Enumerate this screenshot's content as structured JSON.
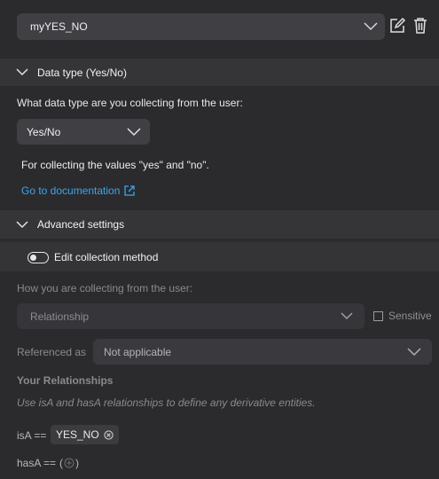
{
  "top": {
    "field_name": "myYES_NO"
  },
  "data_type_section": {
    "title": "Data type (Yes/No)",
    "question": "What data type are you collecting from the user:",
    "selected_type": "Yes/No",
    "description": "For collecting the values \"yes\" and \"no\".",
    "doc_link": "Go to documentation"
  },
  "advanced_section": {
    "title": "Advanced settings",
    "toggle_label": "Edit collection method",
    "toggle_on": false,
    "collecting_label": "How you are collecting from the user:",
    "collecting_value": "Relationship",
    "sensitive_label": "Sensitive",
    "sensitive_checked": false,
    "referenced_label": "Referenced as",
    "referenced_value": "Not applicable",
    "relationships_title": "Your Relationships",
    "relationships_hint": "Use isA and hasA relationships to define any derivative entities.",
    "isa_label": "isA ==",
    "isa_chip": "YES_NO",
    "hasa_label": "hasA =="
  },
  "colors": {
    "background": "#2b2b2d",
    "section_header": "#353538",
    "link": "#3aa6ee"
  }
}
